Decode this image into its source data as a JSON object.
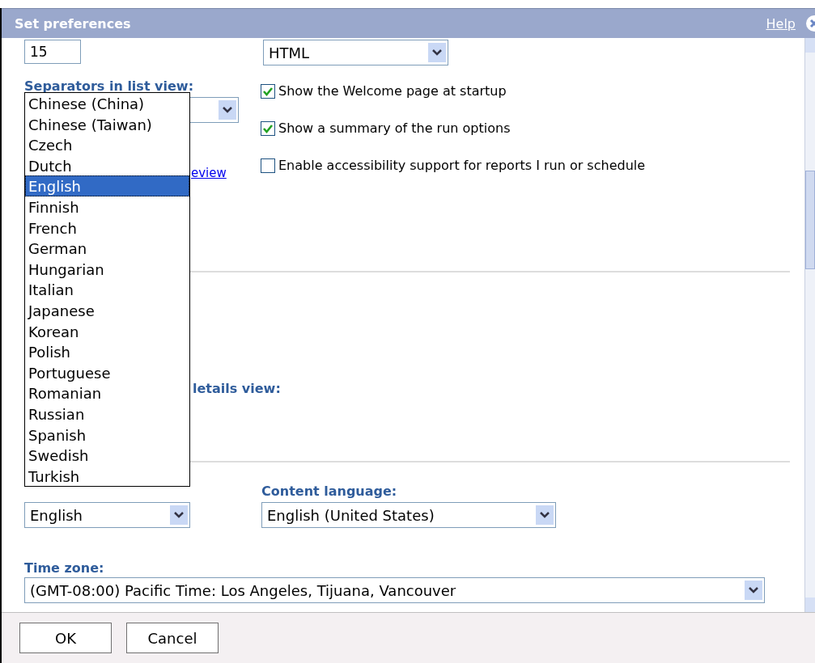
{
  "window": {
    "title": "Set preferences",
    "help_link": "Help"
  },
  "entries_field": {
    "value": "15"
  },
  "style_select": {
    "value": "HTML"
  },
  "separators": {
    "label": "Separators in list view:"
  },
  "preview_link": "eview",
  "options": [
    {
      "label": "Show the Welcome page at startup",
      "checked": true
    },
    {
      "label": "Show a summary of the run options",
      "checked": true
    },
    {
      "label": "Enable accessibility support for reports I run or schedule",
      "checked": false
    }
  ],
  "details_label": "letails view:",
  "language_list": [
    {
      "label": "Chinese (China)",
      "selected": false
    },
    {
      "label": "Chinese (Taiwan)",
      "selected": false
    },
    {
      "label": "Czech",
      "selected": false
    },
    {
      "label": "Dutch",
      "selected": false
    },
    {
      "label": "English",
      "selected": true
    },
    {
      "label": "Finnish",
      "selected": false
    },
    {
      "label": "French",
      "selected": false
    },
    {
      "label": "German",
      "selected": false
    },
    {
      "label": "Hungarian",
      "selected": false
    },
    {
      "label": "Italian",
      "selected": false
    },
    {
      "label": "Japanese",
      "selected": false
    },
    {
      "label": "Korean",
      "selected": false
    },
    {
      "label": "Polish",
      "selected": false
    },
    {
      "label": "Portuguese",
      "selected": false
    },
    {
      "label": "Romanian",
      "selected": false
    },
    {
      "label": "Russian",
      "selected": false
    },
    {
      "label": "Spanish",
      "selected": false
    },
    {
      "label": "Swedish",
      "selected": false
    },
    {
      "label": "Turkish",
      "selected": false
    }
  ],
  "product_language": {
    "value": "English"
  },
  "content_language": {
    "label": "Content language:",
    "value": "English (United States)"
  },
  "time_zone": {
    "label": "Time zone:",
    "value": "(GMT-08:00) Pacific Time: Los Angeles, Tijuana, Vancouver"
  },
  "buttons": [
    "OK",
    "Cancel"
  ]
}
